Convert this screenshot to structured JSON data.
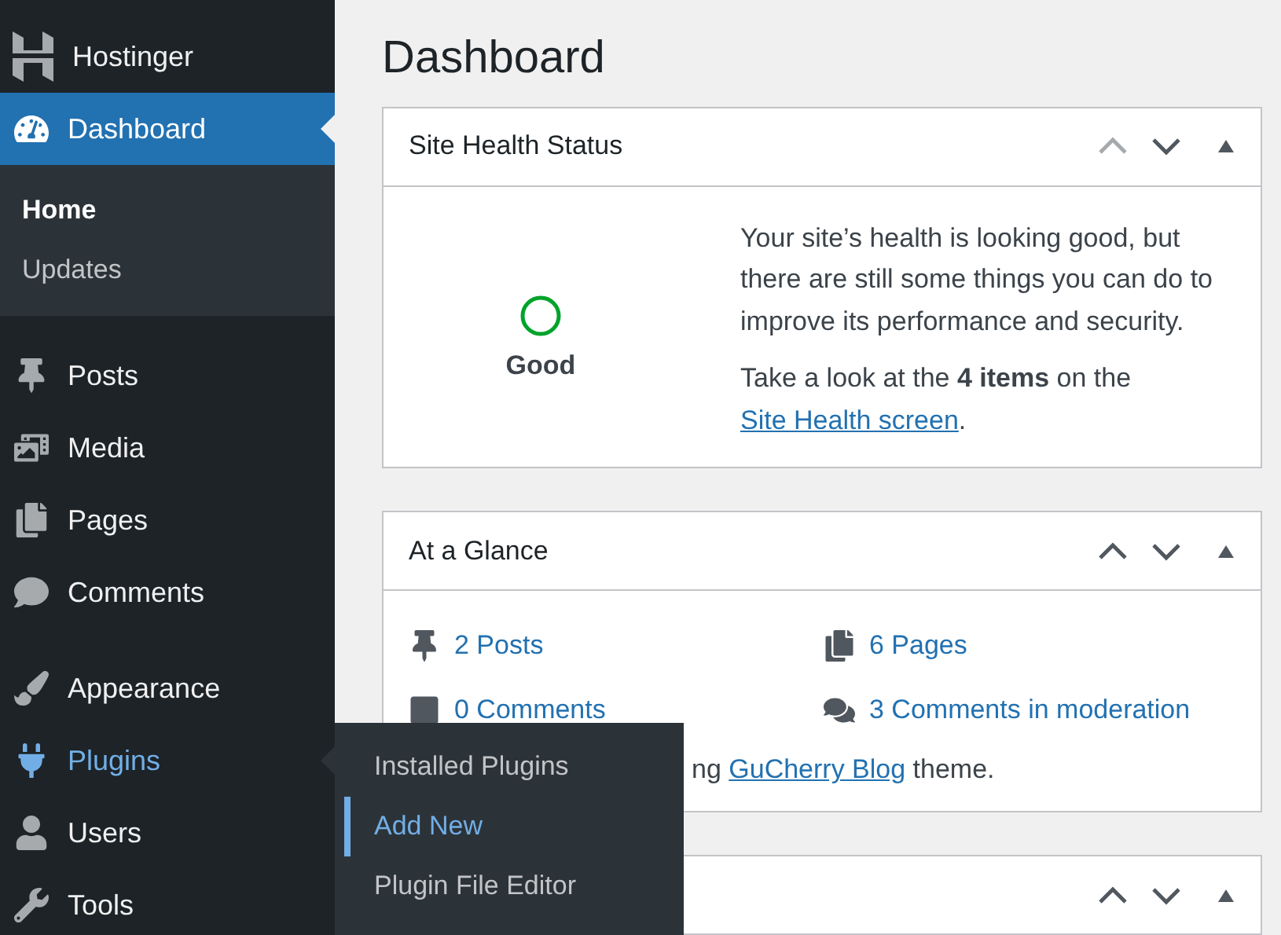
{
  "sidebar": {
    "brand": "Hostinger",
    "sections": [
      {
        "items": [
          {
            "label": "Dashboard",
            "selected": true,
            "expanded": false,
            "submenu": [
              {
                "label": "Home",
                "selected": true
              },
              {
                "label": "Updates",
                "selected": false
              }
            ]
          }
        ]
      },
      {
        "items": [
          {
            "label": "Posts",
            "selected": false,
            "expanded": false
          },
          {
            "label": "Media",
            "selected": false,
            "expanded": false
          },
          {
            "label": "Pages",
            "selected": false,
            "expanded": false
          },
          {
            "label": "Comments",
            "selected": false,
            "expanded": false
          }
        ]
      },
      {
        "items": [
          {
            "label": "Appearance",
            "selected": false,
            "expanded": false
          },
          {
            "label": "Plugins",
            "selected": false,
            "expanded": true,
            "flyout": [
              {
                "label": "Installed Plugins",
                "selected": false
              },
              {
                "label": "Add New",
                "selected": true
              },
              {
                "label": "Plugin File Editor",
                "selected": false
              }
            ]
          },
          {
            "label": "Users",
            "selected": false,
            "expanded": false
          },
          {
            "label": "Tools",
            "selected": false,
            "expanded": false
          }
        ]
      }
    ]
  },
  "page_title": "Dashboard",
  "widgets": [
    {
      "kind": "health",
      "title": "Site Health Status",
      "up_disabled": true,
      "status": "Good",
      "message": "Your site’s health is looking good, but there are still some things you can do to improve its performance and security.",
      "items_text": "Take a look at the **4 items** on the ",
      "items_link": "Site Health screen",
      "items_after": "."
    },
    {
      "kind": "glance",
      "title": "At a Glance",
      "up_disabled": false,
      "stats": [
        {
          "label": "2 Posts"
        },
        {
          "label": "6 Pages"
        },
        {
          "label": "0 Comments"
        },
        {
          "label": "3 Comments in moderation"
        }
      ],
      "theme_before": "ng ",
      "theme_link": "GuCherry Blog",
      "theme_after": " theme."
    },
    {
      "kind": "empty",
      "up_disabled": false
    }
  ]
}
